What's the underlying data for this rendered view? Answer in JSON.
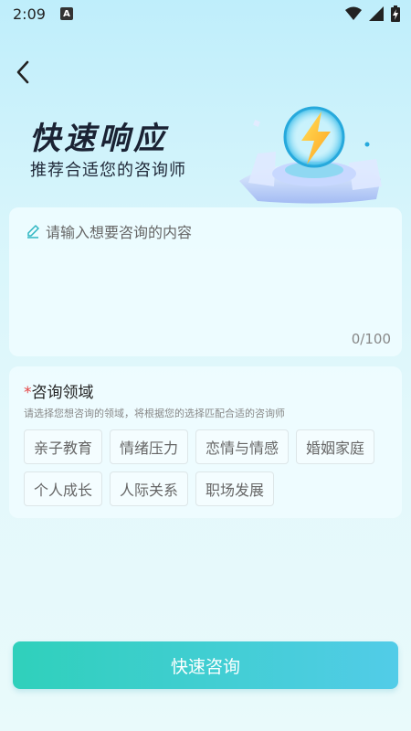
{
  "status_bar": {
    "time": "2:09",
    "indicator": "A"
  },
  "hero": {
    "title": "快速响应",
    "subtitle": "推荐合适您的咨询师"
  },
  "input": {
    "placeholder": "请输入想要咨询的内容",
    "counter": "0/100"
  },
  "field": {
    "required_mark": "*",
    "title": "咨询领域",
    "description": "请选择您想咨询的领域，将根据您的选择匹配合适的咨询师",
    "tags": [
      "亲子教育",
      "情绪压力",
      "恋情与情感",
      "婚姻家庭",
      "个人成长",
      "人际关系",
      "职场发展"
    ]
  },
  "submit": {
    "label": "快速咨询"
  },
  "colors": {
    "accent_start": "#2fd0bb",
    "accent_end": "#52cce8",
    "required": "#e54545"
  }
}
